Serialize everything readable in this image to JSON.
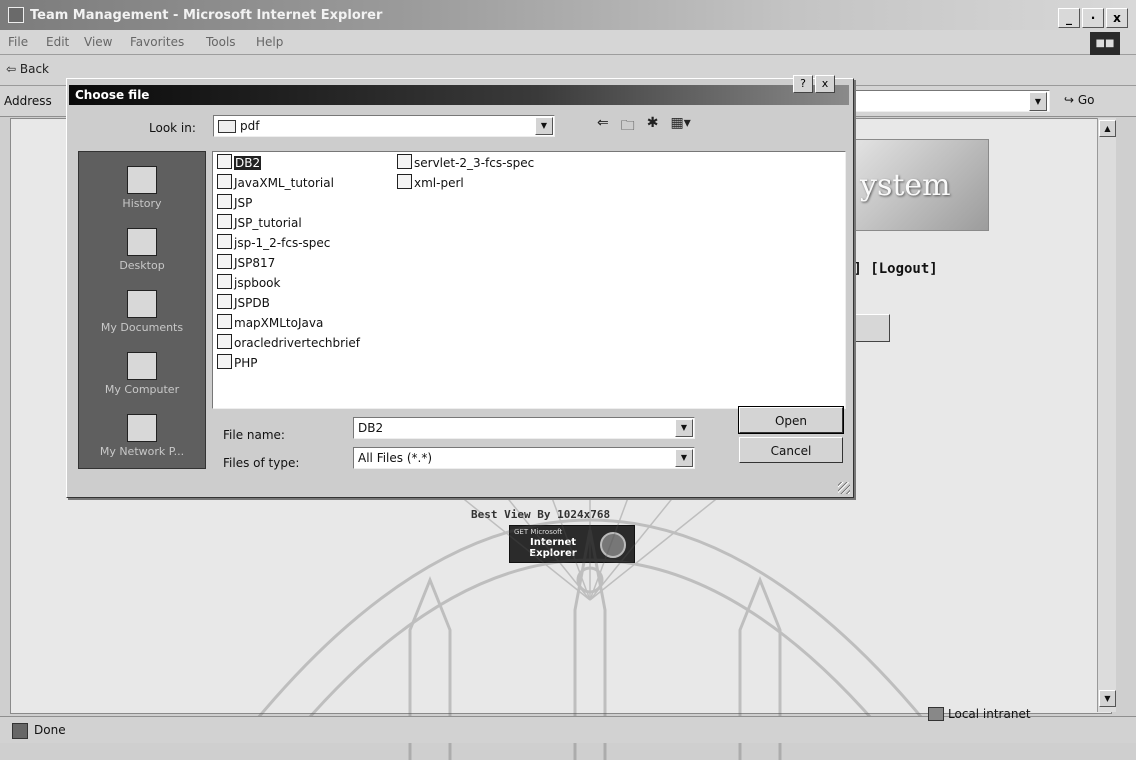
{
  "browser": {
    "title": "Team Management - Microsoft Internet Explorer",
    "window_controls": [
      "_",
      "·",
      "x"
    ],
    "menu": [
      "File",
      "Edit",
      "View",
      "Favorites",
      "Tools",
      "Help"
    ],
    "back_label": "⇦ Back",
    "address_label": "Address",
    "go_label": "↪ Go",
    "status_text": "Done",
    "zone_text": "Local intranet"
  },
  "page": {
    "banner_text": "ystem",
    "links_text": "e] [Logout]",
    "best_view": "Best View By 1024x768",
    "ie_badge": {
      "line1": "GET Microsoft",
      "line2": "Internet Explorer"
    }
  },
  "dialog": {
    "title": "Choose file",
    "help_btn": "?",
    "close_btn": "x",
    "look_in_label": "Look in:",
    "look_in_value": "pdf",
    "places": [
      "History",
      "Desktop",
      "My Documents",
      "My Computer",
      "My Network P..."
    ],
    "files_col1": [
      "DB2",
      "JavaXML_tutorial",
      "JSP",
      "JSP_tutorial",
      "jsp-1_2-fcs-spec",
      "JSP817",
      "jspbook",
      "JSPDB",
      "mapXMLtoJava",
      "oracledrivertechbrief",
      "PHP"
    ],
    "files_col2": [
      "servlet-2_3-fcs-spec",
      "xml-perl"
    ],
    "selected_file": "DB2",
    "file_name_label": "File name:",
    "file_name_value": "DB2",
    "files_of_type_label": "Files of type:",
    "files_of_type_value": "All Files (*.*)",
    "open_label": "Open",
    "cancel_label": "Cancel"
  }
}
